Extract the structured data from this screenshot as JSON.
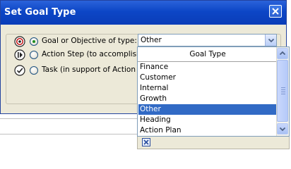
{
  "dialog": {
    "title": "Set Goal Type"
  },
  "options": [
    {
      "label": "Goal or Objective of type:",
      "icon": "goal-target-icon",
      "checked": true
    },
    {
      "label": "Action Step (to accomplish a",
      "icon": "action-step-icon",
      "checked": false
    },
    {
      "label": "Task (in support of Action St",
      "icon": "task-check-icon",
      "checked": false
    }
  ],
  "select": {
    "value": "Other"
  },
  "dropdown": {
    "header": "Goal Type",
    "items": [
      "Finance",
      "Customer",
      "Internal",
      "Growth",
      "Other",
      "Heading",
      "Action Plan"
    ],
    "selected": "Other"
  },
  "colors": {
    "title_bar": "#0c46c6",
    "selection": "#316ac5",
    "radio_dot": "#1e8d1e",
    "dialog_bg": "#ece9d8"
  }
}
